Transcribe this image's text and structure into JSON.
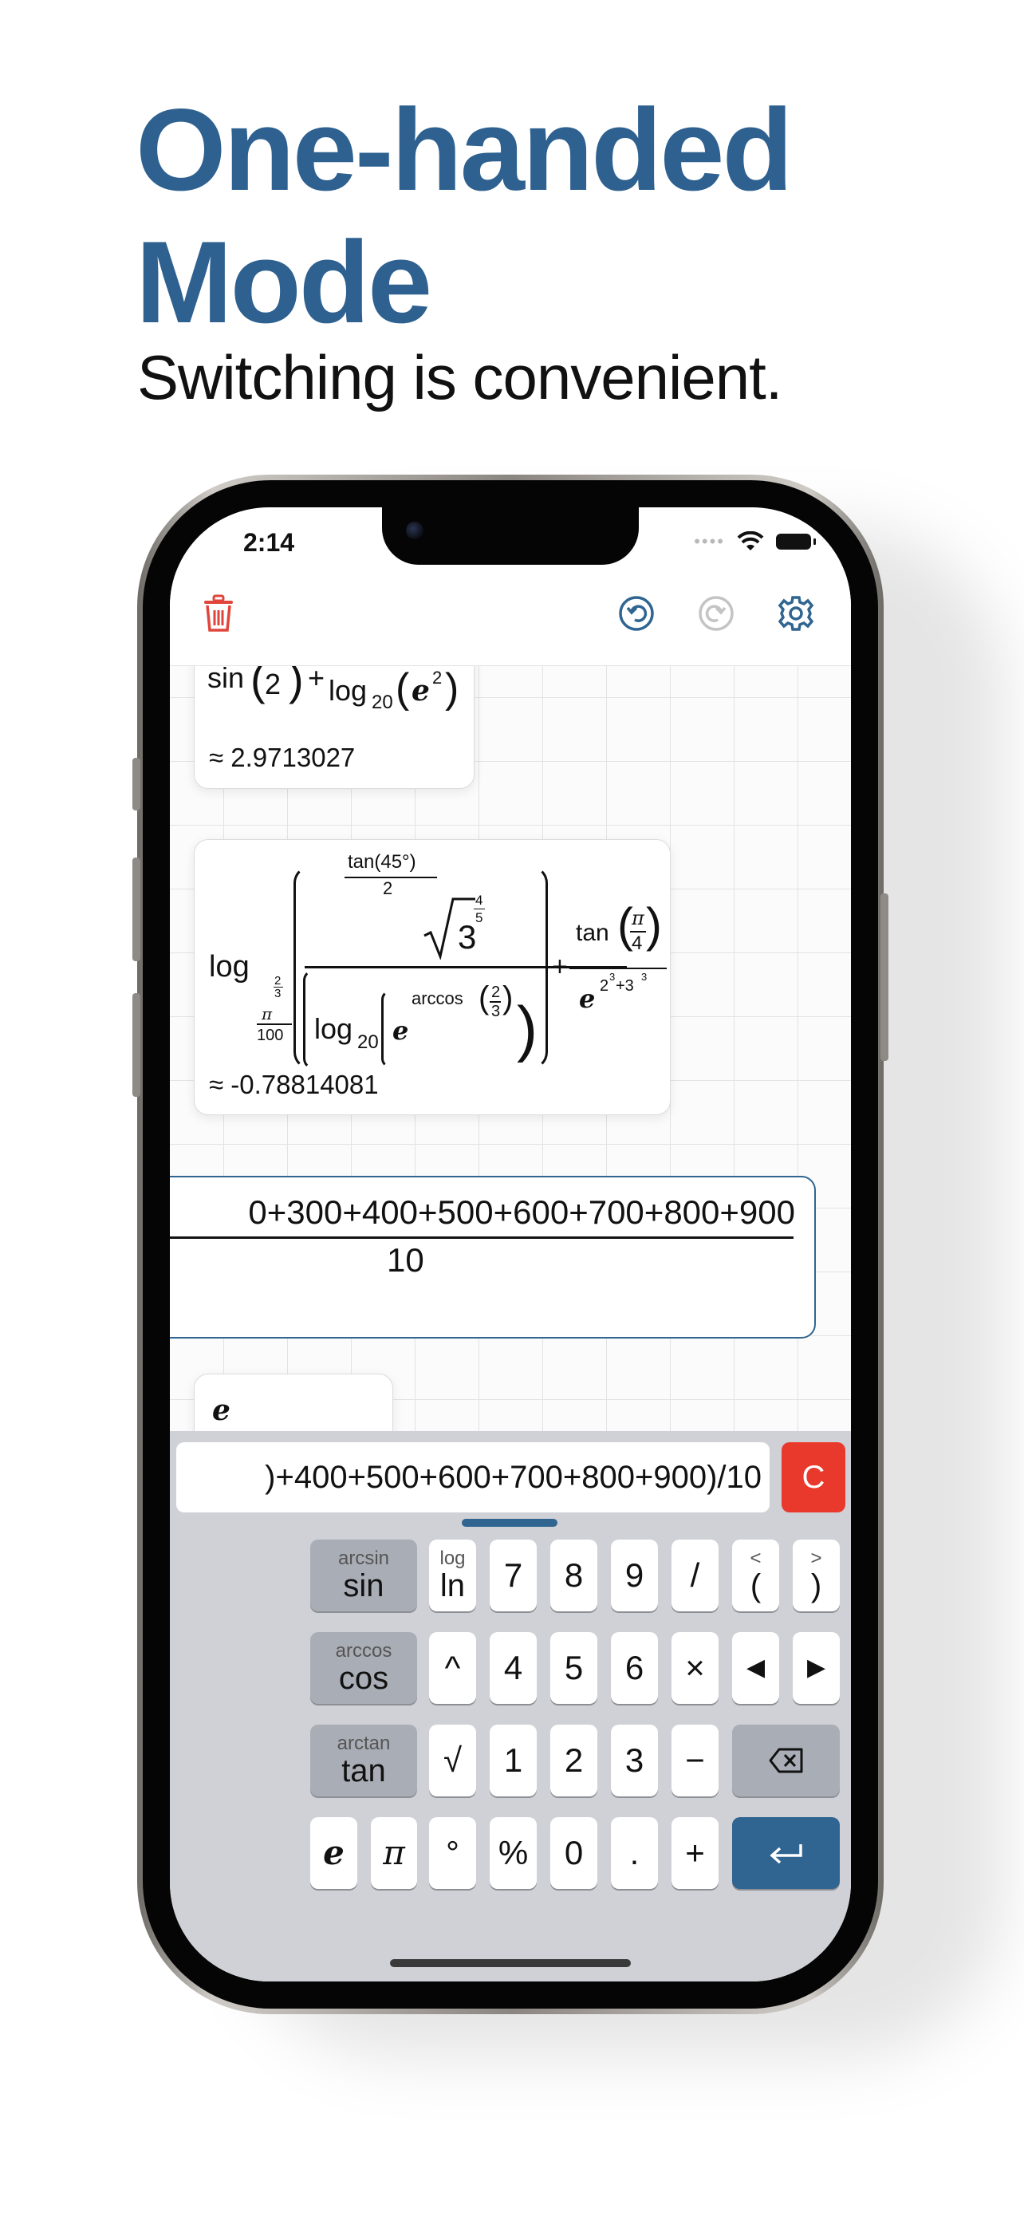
{
  "headline": {
    "line1": "One-handed",
    "line2": "Mode",
    "subtitle": "Switching is convenient."
  },
  "status_bar": {
    "time": "2:14"
  },
  "toolbar": {
    "icons": [
      "trash-icon",
      "undo-icon",
      "redo-icon",
      "gear-icon"
    ]
  },
  "colors": {
    "accent": "#2f6590",
    "headline": "#2e6190",
    "clear_button": "#e8392c",
    "delete_icon": "#e0453b"
  },
  "cards": [
    {
      "expr": {
        "t1": "sin",
        "n": "2",
        "op": "+",
        "den_log": "log",
        "den_sub": "20",
        "e": "e",
        "e_sup": "2"
      },
      "result": "≈ 2.9713027"
    },
    {
      "expr": {
        "log": "log",
        "base_num": "π",
        "base_den": "100",
        "base_exp_num": "2",
        "base_exp_den": "3",
        "frac_top": "tan(45°)",
        "frac_top_den": "2",
        "root_base": "3",
        "root_exp_num": "4",
        "root_exp_den": "5",
        "den_log": "log",
        "den_sub": "20",
        "e": "e",
        "arccos": "arccos",
        "ac_num": "2",
        "ac_den": "3",
        "plus": "+",
        "tan": "tan",
        "pi": "π",
        "four": "4",
        "e2": "e",
        "e2_exp_a": "2",
        "e2_exp_a_sup": "3",
        "e2_exp_b": "+3",
        "e2_exp_b_sup": "3"
      },
      "result": "≈ -0.78814081"
    },
    {
      "expr": {
        "numerator": "0+300+400+500+600+700+800+900",
        "denominator": "10"
      },
      "result": ""
    },
    {
      "expr": {
        "e": "e"
      },
      "result": ""
    }
  ],
  "input": {
    "value": ")+400+500+600+700+800+900)/10",
    "clear_label": "C"
  },
  "keyboard": {
    "rows": [
      [
        {
          "sub": "arcsin",
          "main": "sin"
        },
        {
          "sub": "log",
          "main": "ln"
        },
        {
          "sub": "",
          "main": "7"
        },
        {
          "sub": "",
          "main": "8"
        },
        {
          "sub": "",
          "main": "9"
        },
        {
          "sub": "",
          "main": "/"
        },
        {
          "sub": "<",
          "main": "("
        },
        {
          "sub": ">",
          "main": ")"
        }
      ],
      [
        {
          "sub": "arccos",
          "main": "cos"
        },
        {
          "sub": "",
          "main": "^"
        },
        {
          "sub": "",
          "main": "4"
        },
        {
          "sub": "",
          "main": "5"
        },
        {
          "sub": "",
          "main": "6"
        },
        {
          "sub": "",
          "main": "×"
        },
        {
          "sub": "",
          "main": "◀"
        },
        {
          "sub": "",
          "main": "▶"
        }
      ],
      [
        {
          "sub": "arctan",
          "main": "tan"
        },
        {
          "sub": "",
          "main": "√"
        },
        {
          "sub": "",
          "main": "1"
        },
        {
          "sub": "",
          "main": "2"
        },
        {
          "sub": "",
          "main": "3"
        },
        {
          "sub": "",
          "main": "−"
        },
        {
          "sub": "",
          "main": "backspace-icon"
        }
      ],
      [
        {
          "sub": "",
          "main": "e"
        },
        {
          "sub": "",
          "main": "π"
        },
        {
          "sub": "",
          "main": "°"
        },
        {
          "sub": "",
          "main": "%"
        },
        {
          "sub": "",
          "main": "0"
        },
        {
          "sub": "",
          "main": "."
        },
        {
          "sub": "",
          "main": "+"
        },
        {
          "sub": "",
          "main": "return-icon"
        }
      ]
    ]
  }
}
